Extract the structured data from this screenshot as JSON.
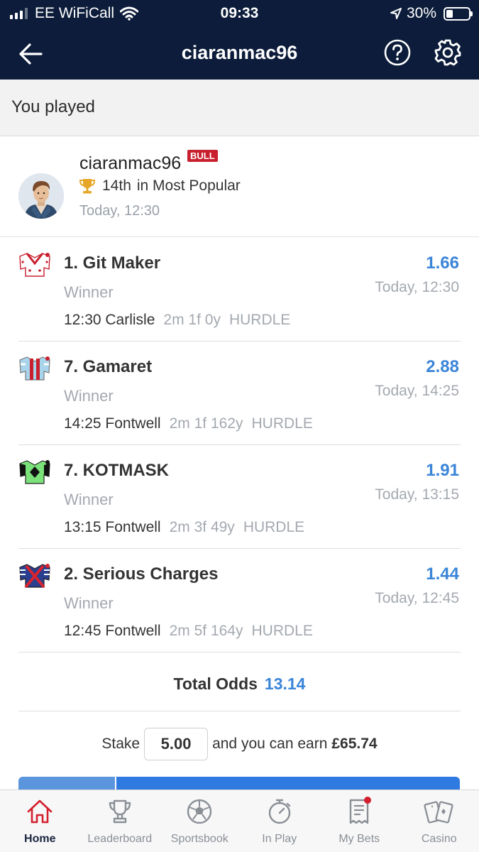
{
  "status_bar": {
    "carrier": "EE WiFiCall",
    "time": "09:33",
    "battery": "30%",
    "battery_level": 0.3
  },
  "nav": {
    "title": "ciaranmac96",
    "back_icon": "arrow-left-icon",
    "help_icon": "question-circle-icon",
    "settings_icon": "gear-icon"
  },
  "section": {
    "title": "You played"
  },
  "user": {
    "username": "ciaranmac96",
    "badge": "BULL",
    "rank": "14th",
    "rank_context": "in Most Popular",
    "time": "Today, 12:30"
  },
  "selections": [
    {
      "name": "1. Git Maker",
      "market": "Winner",
      "race_time_course": "12:30 Carlisle",
      "distance": "2m 1f 0y",
      "race_type": "HURDLE",
      "odds": "1.66",
      "time": "Today, 12:30"
    },
    {
      "name": "7. Gamaret",
      "market": "Winner",
      "race_time_course": "14:25 Fontwell",
      "distance": "2m 1f 162y",
      "race_type": "HURDLE",
      "odds": "2.88",
      "time": "Today, 14:25"
    },
    {
      "name": "7. KOTMASK",
      "market": "Winner",
      "race_time_course": "13:15 Fontwell",
      "distance": "2m 3f 49y",
      "race_type": "HURDLE",
      "odds": "1.91",
      "time": "Today, 13:15"
    },
    {
      "name": "2. Serious Charges",
      "market": "Winner",
      "race_time_course": "12:45 Fontwell",
      "distance": "2m 5f 164y",
      "race_type": "HURDLE",
      "odds": "1.44",
      "time": "Today, 12:45"
    }
  ],
  "total": {
    "label": "Total Odds",
    "value": "13.14"
  },
  "stake": {
    "label": "Stake",
    "value": "5.00",
    "earn_text": "and you can earn",
    "earn_amount": "£65.74"
  },
  "tabs": [
    {
      "label": "Home",
      "icon": "home-icon",
      "active": true
    },
    {
      "label": "Leaderboard",
      "icon": "trophy-icon",
      "active": false
    },
    {
      "label": "Sportsbook",
      "icon": "football-icon",
      "active": false
    },
    {
      "label": "In Play",
      "icon": "stopwatch-icon",
      "active": false
    },
    {
      "label": "My Bets",
      "icon": "betslip-icon",
      "active": false
    },
    {
      "label": "Casino",
      "icon": "cards-icon",
      "active": false
    }
  ],
  "colors": {
    "header_bg": "#0c1c3a",
    "accent_blue": "#3a85d8",
    "badge_red": "#c8202e",
    "active_tab": "#d3202e"
  }
}
